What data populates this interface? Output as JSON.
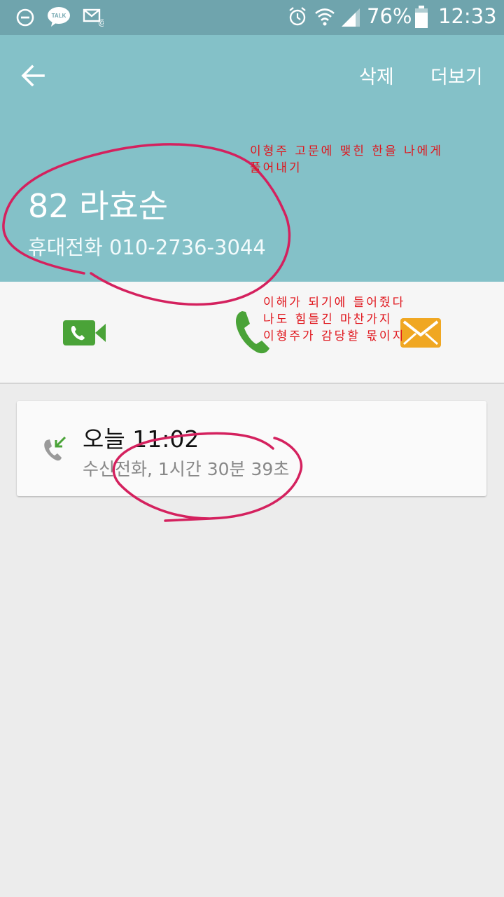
{
  "status_bar": {
    "battery": "76%",
    "time": "12:33",
    "icons": [
      "minus-circle-icon",
      "talk-icon",
      "mail-icon",
      "alarm-icon",
      "wifi-icon",
      "signal-icon",
      "battery-icon"
    ],
    "talk_text": "TALK"
  },
  "header": {
    "back_icon": "back-arrow-icon",
    "delete_label": "삭제",
    "more_label": "더보기",
    "contact_name": "82 라효순",
    "phone_line": "휴대전화 010-2736-3044",
    "color": "#84c1c8"
  },
  "actions": [
    {
      "icon": "video-call-icon",
      "color": "#4aa338"
    },
    {
      "icon": "phone-call-icon",
      "color": "#4aa338"
    },
    {
      "icon": "message-icon",
      "color": "#f0a722"
    }
  ],
  "call_log": {
    "icon": "incoming-call-icon",
    "title": "오늘 11:02",
    "detail": "수신전화, 1시간 30분 39초"
  },
  "annotations": {
    "note1_line1": "이형주 고문에 맺힌 한을 나에게",
    "note1_line2": "풀어내기",
    "note2_line1": "이해가 되기에 들어줬다",
    "note2_line2": "나도 힘들긴 마찬가지",
    "note2_line3": "이형주가 감당할 몫이지",
    "ink_color": "#d4215e"
  }
}
